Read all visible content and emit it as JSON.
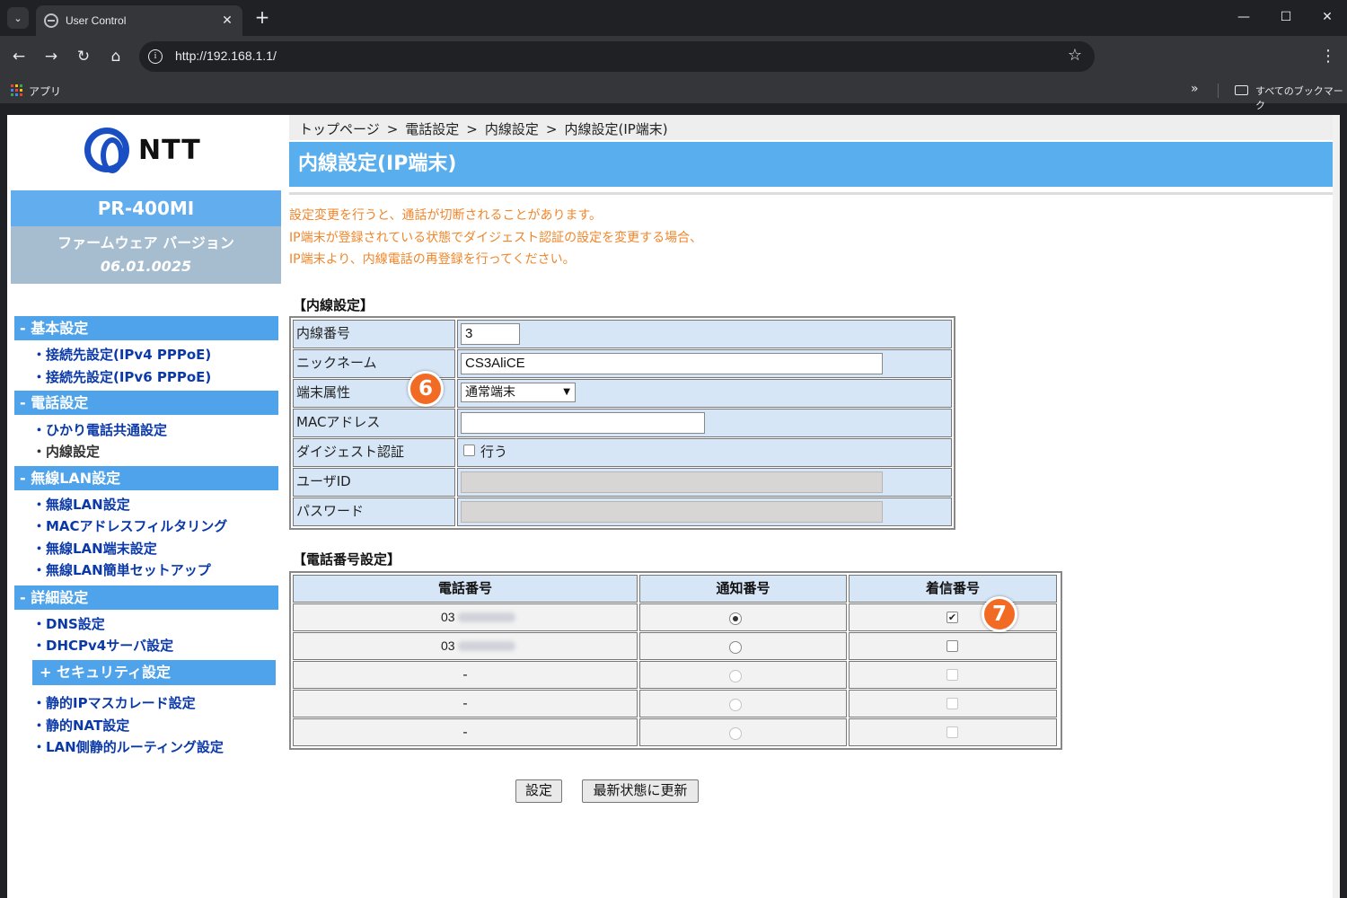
{
  "browser": {
    "tab_title": "User Control",
    "tab_close": "✕",
    "new_tab": "+",
    "url": "http://192.168.1.1/",
    "apps_label": "アプリ",
    "bookmarks_more": "»",
    "all_bookmarks": "すべてのブックマーク",
    "window_controls": [
      "—",
      "☐",
      "✕"
    ],
    "nav_icons": [
      "back-arrow-icon",
      "forward-arrow-icon",
      "reload-icon",
      "home-icon"
    ],
    "nav_glyphs": [
      "←",
      "→",
      "↻",
      "⌂"
    ],
    "info_glyph": "i",
    "star_glyph": "☆",
    "menu_glyph": "⋮",
    "search_glyph": "⌄"
  },
  "sidebar": {
    "logo_text": "NTT",
    "model": "PR-400MI",
    "firmware_label": "ファームウェア バージョン",
    "firmware_version": "06.01.0025",
    "sections": [
      {
        "title": "- 基本設定",
        "items": [
          "・接続先設定(IPv4 PPPoE)",
          "・接続先設定(IPv6 PPPoE)"
        ]
      },
      {
        "title": "- 電話設定",
        "items": [
          "・ひかり電話共通設定",
          "・内線設定"
        ]
      },
      {
        "title": "- 無線LAN設定",
        "items": [
          "・無線LAN設定",
          "・MACアドレスフィルタリング",
          "・無線LAN端末設定",
          "・無線LAN簡単セットアップ"
        ]
      },
      {
        "title": "- 詳細設定",
        "items": [
          "・DNS設定",
          "・DHCPv4サーバ設定"
        ]
      }
    ],
    "security": {
      "title": "+ セキュリティ設定",
      "items": [
        "・静的IPマスカレード設定",
        "・静的NAT設定",
        "・LAN側静的ルーティング設定"
      ]
    }
  },
  "content": {
    "breadcrumb": [
      "トップページ",
      "電話設定",
      "内線設定",
      "内線設定(IP端末)"
    ],
    "breadcrumb_sep": ">",
    "title": "内線設定(IP端末)",
    "warnings": [
      "設定変更を行うと、通話が切断されることがあります。",
      "IP端末が登録されている状態でダイジェスト認証の設定を変更する場合、",
      "IP端末より、内線電話の再登録を行ってください。"
    ],
    "extension_section": "【内線設定】",
    "extension_fields": {
      "number_label": "内線番号",
      "number_value": "3",
      "nickname_label": "ニックネーム",
      "nickname_value": "CS3AliCE",
      "attribute_label": "端末属性",
      "attribute_value": "通常端末",
      "mac_label": "MACアドレス",
      "mac_value": "",
      "digest_label": "ダイジェスト認証",
      "digest_option": "行う",
      "digest_checked": false,
      "userid_label": "ユーザID",
      "password_label": "パスワード"
    },
    "phone_section": "【電話番号設定】",
    "phone_headers": [
      "電話番号",
      "通知番号",
      "着信番号"
    ],
    "phone_rows": [
      {
        "number": "03",
        "blurred": true,
        "notify": "selected",
        "incoming": true,
        "enabled": true
      },
      {
        "number": "03",
        "blurred": true,
        "notify": "unselected",
        "incoming": false,
        "enabled": true
      },
      {
        "number": "-",
        "blurred": false,
        "notify": "unselected",
        "incoming": false,
        "enabled": false
      },
      {
        "number": "-",
        "blurred": false,
        "notify": "unselected",
        "incoming": false,
        "enabled": false
      },
      {
        "number": "-",
        "blurred": false,
        "notify": "unselected",
        "incoming": false,
        "enabled": false
      }
    ],
    "buttons": {
      "save": "設定",
      "refresh": "最新状態に更新"
    },
    "annotations": [
      "6",
      "7"
    ]
  },
  "colors": {
    "title_bar": "#59aeee",
    "menu_head": "#4fa3ea",
    "menu_link": "#0b3aa8",
    "warning_text": "#f0862b",
    "table_label_bg": "#d7e6f7",
    "badge": "#f26b24",
    "logo_blue": "#1a4fc4"
  }
}
